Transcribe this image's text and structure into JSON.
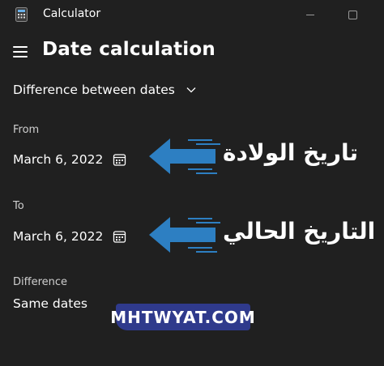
{
  "window": {
    "title": "Calculator",
    "minimize_icon": "minimize-icon",
    "maximize_icon": "maximize-icon"
  },
  "header": {
    "menu_icon": "hamburger-menu-icon",
    "title": "Date calculation"
  },
  "mode": {
    "selected": "Difference between dates",
    "icon": "chevron-down-icon"
  },
  "from": {
    "label": "From",
    "value": "March 6, 2022",
    "icon": "calendar-icon"
  },
  "to": {
    "label": "To",
    "value": "March 6, 2022",
    "icon": "calendar-icon"
  },
  "difference": {
    "label": "Difference",
    "value": "Same dates"
  },
  "annotations": {
    "birth_date": "تاريخ الولادة",
    "current_date": "التاريخ الحالي",
    "watermark": "MHTWYAT.COM"
  },
  "colors": {
    "background": "#202020",
    "arrow": "#2d7fc2",
    "watermark_bg": "#2f3a8c"
  }
}
